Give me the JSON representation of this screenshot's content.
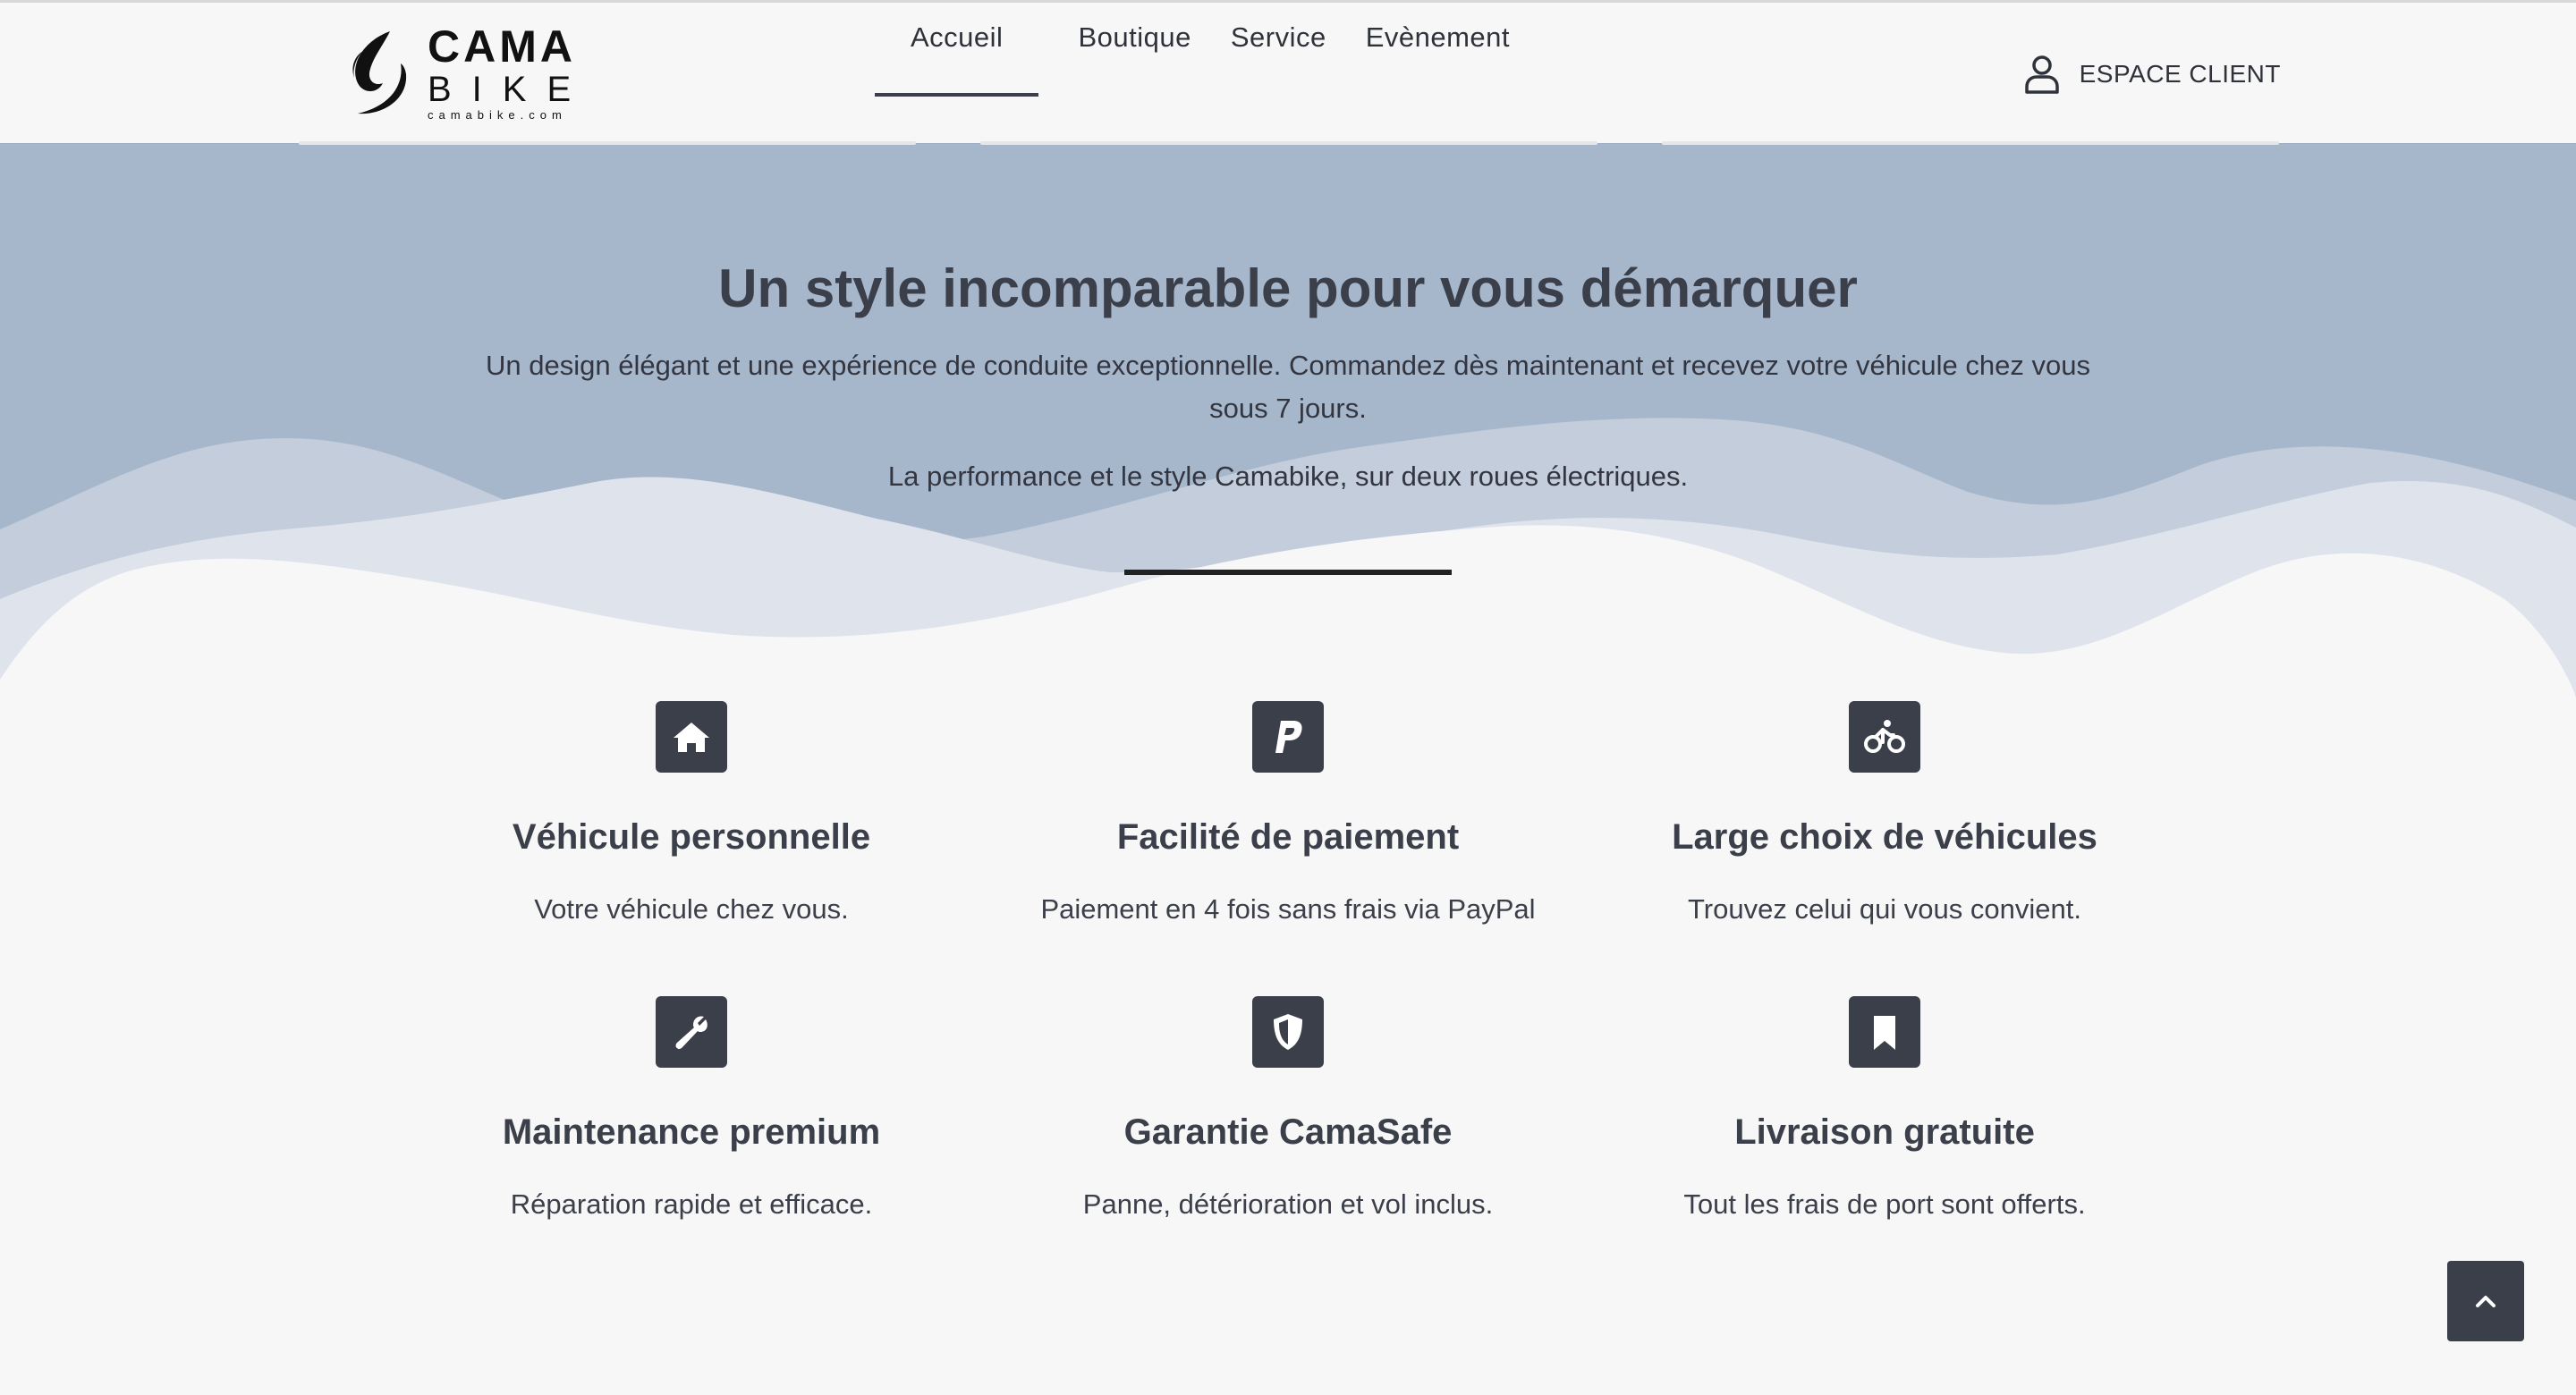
{
  "brand": {
    "line1": "CAMA",
    "line2": "BIKE",
    "line3": "camabike.com"
  },
  "nav": {
    "items": [
      {
        "label": "Accueil",
        "active": true
      },
      {
        "label": "Boutique",
        "active": false
      },
      {
        "label": "Service",
        "active": false
      },
      {
        "label": "Evènement",
        "active": false
      }
    ],
    "client_label": "ESPACE CLIENT",
    "client_icon": "user-icon"
  },
  "hero": {
    "title": "Un style incomparable pour vous démarquer",
    "paragraph1": "Un design élégant et une expérience de conduite exceptionnelle. Commandez dès maintenant et recevez votre véhicule chez vous sous 7 jours.",
    "paragraph2": "La performance et le style Camabike, sur deux roues électriques.",
    "background_color": "#a6b6cb"
  },
  "features": [
    {
      "icon": "home-icon",
      "title": "Véhicule personnelle",
      "text": "Votre véhicule chez vous."
    },
    {
      "icon": "paypal-icon",
      "title": "Facilité de paiement",
      "text": "Paiement en 4 fois sans frais via PayPal"
    },
    {
      "icon": "bicycle-icon",
      "title": "Large choix de véhicules",
      "text": "Trouvez celui qui vous convient."
    },
    {
      "icon": "wrench-icon",
      "title": "Maintenance premium",
      "text": "Réparation rapide et efficace."
    },
    {
      "icon": "shield-icon",
      "title": "Garantie CamaSafe",
      "text": "Panne, détérioration et vol inclus."
    },
    {
      "icon": "bookmark-icon",
      "title": "Livraison gratuite",
      "text": "Tout les frais de port sont offerts."
    }
  ],
  "colors": {
    "accent": "#3b3f4a",
    "page_background": "#f7f7f7"
  },
  "scroll_top_icon": "chevron-up-icon"
}
